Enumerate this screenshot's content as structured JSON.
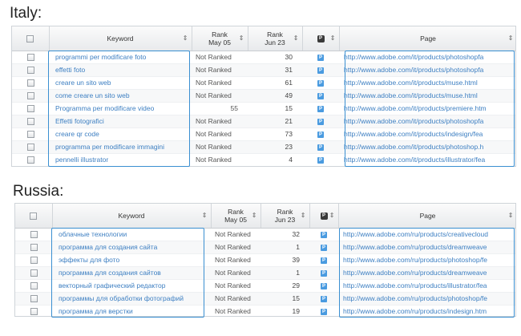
{
  "italy": {
    "title": "Italy:",
    "columns": {
      "keyword": "Keyword",
      "rank_may_1": "Rank",
      "rank_may_2": "May 05",
      "rank_jun_1": "Rank",
      "rank_jun_2": "Jun 23",
      "page": "Page",
      "p_icon": "P"
    },
    "rows": [
      {
        "keyword": "programmi per modificare foto",
        "rank_may": "Not Ranked",
        "rank_jun": "30",
        "page": "http://www.adobe.com/it/products/photoshopfa"
      },
      {
        "keyword": "effetti foto",
        "rank_may": "Not Ranked",
        "rank_jun": "31",
        "page": "http://www.adobe.com/it/products/photoshopfa"
      },
      {
        "keyword": "creare un sito web",
        "rank_may": "Not Ranked",
        "rank_jun": "61",
        "page": "http://www.adobe.com/it/products/muse.html"
      },
      {
        "keyword": "come creare un sito web",
        "rank_may": "Not Ranked",
        "rank_jun": "49",
        "page": "http://www.adobe.com/it/products/muse.html"
      },
      {
        "keyword": "Programma per modificare video",
        "rank_may": "55",
        "rank_jun": "15",
        "page": "http://www.adobe.com/it/products/premiere.htm"
      },
      {
        "keyword": "Effetti fotografici",
        "rank_may": "Not Ranked",
        "rank_jun": "21",
        "page": "http://www.adobe.com/it/products/photoshopfa"
      },
      {
        "keyword": "creare qr code",
        "rank_may": "Not Ranked",
        "rank_jun": "73",
        "page": "http://www.adobe.com/it/products/indesign/fea"
      },
      {
        "keyword": "programma per modificare immagini",
        "rank_may": "Not Ranked",
        "rank_jun": "23",
        "page": "http://www.adobe.com/it/products/photoshop.h"
      },
      {
        "keyword": "pennelli illustrator",
        "rank_may": "Not Ranked",
        "rank_jun": "4",
        "page": "http://www.adobe.com/it/products/illustrator/fea"
      }
    ]
  },
  "russia": {
    "title": "Russia:",
    "columns": {
      "keyword": "Keyword",
      "rank_may_1": "Rank",
      "rank_may_2": "May 05",
      "rank_jun_1": "Rank",
      "rank_jun_2": "Jun 23",
      "page": "Page",
      "p_icon": "P"
    },
    "rows": [
      {
        "keyword": "облачные технологии",
        "rank_may": "Not Ranked",
        "rank_jun": "32",
        "page": "http://www.adobe.com/ru/products/creativecloud"
      },
      {
        "keyword": "программа для создания сайта",
        "rank_may": "Not Ranked",
        "rank_jun": "1",
        "page": "http://www.adobe.com/ru/products/dreamweave"
      },
      {
        "keyword": "эффекты для фото",
        "rank_may": "Not Ranked",
        "rank_jun": "39",
        "page": "http://www.adobe.com/ru/products/photoshop/fe"
      },
      {
        "keyword": "программа для создания сайтов",
        "rank_may": "Not Ranked",
        "rank_jun": "1",
        "page": "http://www.adobe.com/ru/products/dreamweave"
      },
      {
        "keyword": "векторный графический редактор",
        "rank_may": "Not Ranked",
        "rank_jun": "29",
        "page": "http://www.adobe.com/ru/products/illustrator/fea"
      },
      {
        "keyword": "программы для обработки фотографий",
        "rank_may": "Not Ranked",
        "rank_jun": "15",
        "page": "http://www.adobe.com/ru/products/photoshop/fe"
      },
      {
        "keyword": "программа для верстки",
        "rank_may": "Not Ranked",
        "rank_jun": "19",
        "page": "http://www.adobe.com/ru/products/indesign.htm"
      }
    ]
  }
}
